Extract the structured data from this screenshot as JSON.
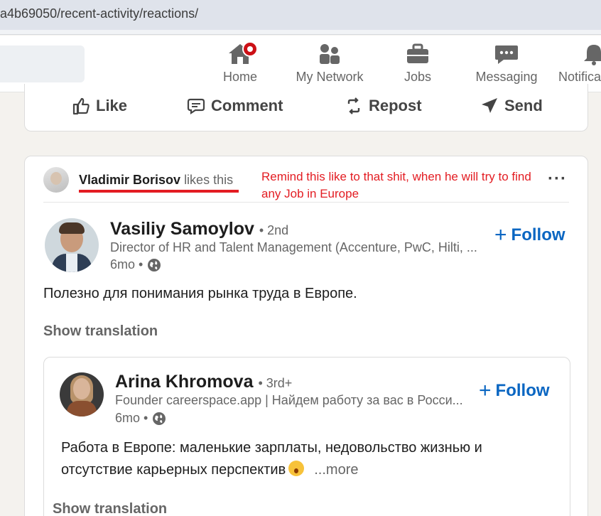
{
  "browser": {
    "url": "a4b69050/recent-activity/reactions/"
  },
  "nav": {
    "items": [
      {
        "label": "Home",
        "icon": "home-icon"
      },
      {
        "label": "My Network",
        "icon": "network-icon"
      },
      {
        "label": "Jobs",
        "icon": "briefcase-icon"
      },
      {
        "label": "Messaging",
        "icon": "messaging-icon"
      },
      {
        "label": "Notifica",
        "icon": "bell-icon"
      }
    ],
    "badge_color": "#cc1016"
  },
  "actions": {
    "like": "Like",
    "comment": "Comment",
    "repost": "Repost",
    "send": "Send"
  },
  "activity": {
    "liker_name": "Vladimir Borisov",
    "liker_action": "likes this",
    "annotation": "Remind this like to that shit, when he will try to find any Job in Europe",
    "annotation_color": "#e31c22",
    "more": "···"
  },
  "post": {
    "author": "Vasiliy Samoylov",
    "degree": "• 2nd",
    "title": "Director of HR and Talent Management (Accenture, PwC, Hilti, ...",
    "time": "6mo •",
    "follow": "Follow",
    "text": "Полезно для понимания рынка труда в Европе.",
    "show_translation": "Show translation"
  },
  "shared": {
    "author": "Arina Khromova",
    "degree": "• 3rd+",
    "title": "Founder careerspace.app | Найдем работу за вас в Росси...",
    "time": "6mo •",
    "follow": "Follow",
    "text": "Работа в Европе: маленькие зарплаты, недовольство жизнью и отсутствие карьерных перспектив",
    "more": "...more",
    "show_translation": "Show translation"
  },
  "accent_color": "#0a66c2"
}
